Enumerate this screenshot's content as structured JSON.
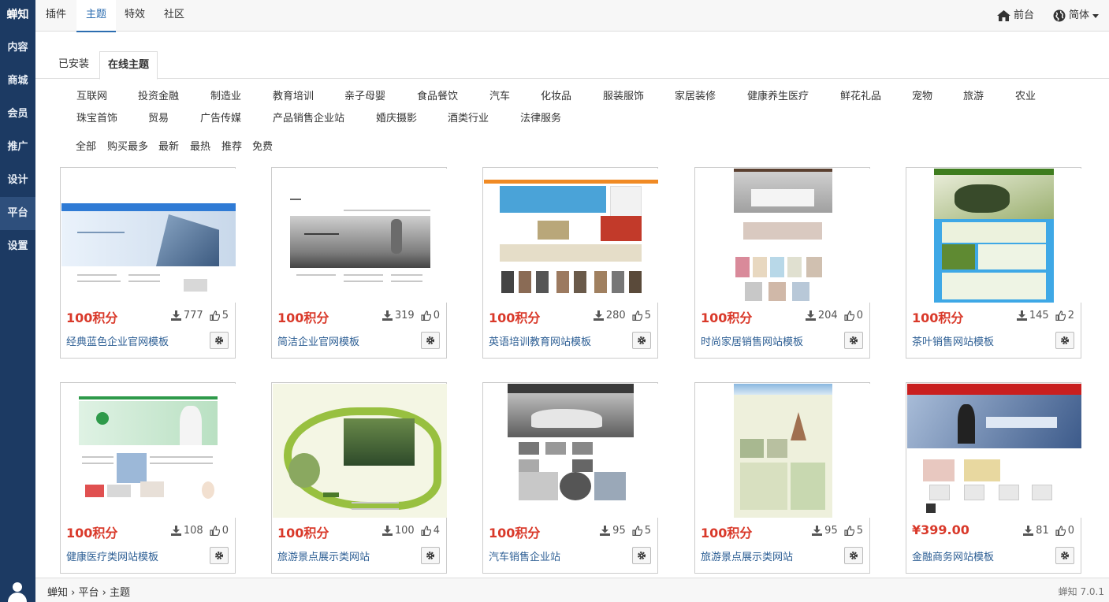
{
  "sidebar": {
    "brand": "蝉知",
    "items": [
      "内容",
      "商城",
      "会员",
      "推广",
      "设计",
      "平台",
      "设置"
    ],
    "active": "平台"
  },
  "topbar": {
    "tabs": [
      "插件",
      "主题",
      "特效",
      "社区"
    ],
    "active_tab": "主题",
    "front_link": "前台",
    "lang_link": "简体"
  },
  "subtabs": {
    "installed": "已安装",
    "online": "在线主题"
  },
  "categories": {
    "row1": [
      "互联网",
      "投资金融",
      "制造业",
      "教育培训",
      "亲子母婴",
      "食品餐饮",
      "汽车",
      "化妆品",
      "服装服饰",
      "家居装修",
      "健康养生医疗",
      "鲜花礼品",
      "宠物",
      "旅游",
      "农业"
    ],
    "row2": [
      "珠宝首饰",
      "贸易",
      "广告传媒",
      "产品销售企业站",
      "婚庆摄影",
      "酒类行业",
      "法律服务"
    ]
  },
  "filters": [
    "全部",
    "购买最多",
    "最新",
    "最热",
    "推荐",
    "免费"
  ],
  "themes": [
    {
      "price": "100积分",
      "downloads": "777",
      "likes": "5",
      "title": "经典蓝色企业官网模板"
    },
    {
      "price": "100积分",
      "downloads": "319",
      "likes": "0",
      "title": "简洁企业官网模板"
    },
    {
      "price": "100积分",
      "downloads": "280",
      "likes": "5",
      "title": "英语培训教育网站模板"
    },
    {
      "price": "100积分",
      "downloads": "204",
      "likes": "0",
      "title": "时尚家居销售网站模板"
    },
    {
      "price": "100积分",
      "downloads": "145",
      "likes": "2",
      "title": "茶叶销售网站模板"
    },
    {
      "price": "100积分",
      "downloads": "108",
      "likes": "0",
      "title": "健康医疗类网站模板"
    },
    {
      "price": "100积分",
      "downloads": "100",
      "likes": "4",
      "title": "旅游景点展示类网站"
    },
    {
      "price": "100积分",
      "downloads": "95",
      "likes": "5",
      "title": "汽车销售企业站"
    },
    {
      "price": "100积分",
      "downloads": "95",
      "likes": "5",
      "title": "旅游景点展示类网站"
    },
    {
      "price": "¥399.00",
      "downloads": "81",
      "likes": "0",
      "title": "金融商务网站模板"
    }
  ],
  "footer": {
    "crumb_root": "蝉知",
    "crumb_mid": "平台",
    "crumb_leaf": "主题",
    "sep": "›",
    "version": "蝉知 7.0.1"
  },
  "colors": {
    "sidebar_bg": "#1c3a63",
    "accent": "#2c6db0",
    "price": "#d9392a"
  }
}
